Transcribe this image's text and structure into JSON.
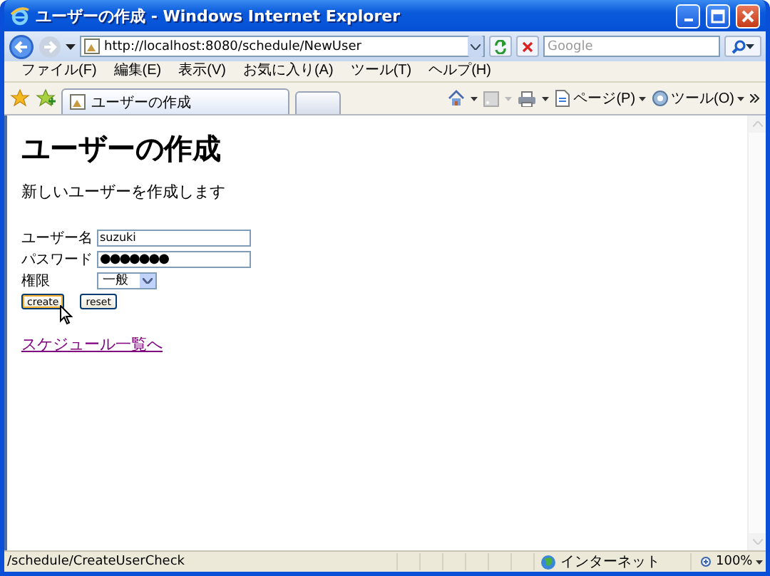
{
  "window": {
    "title": "ユーザーの作成 - Windows Internet Explorer"
  },
  "address_bar": {
    "url": "http://localhost:8080/schedule/NewUser"
  },
  "search": {
    "placeholder": "Google"
  },
  "menu": [
    "ファイル(F)",
    "編集(E)",
    "表示(V)",
    "お気に入り(A)",
    "ツール(T)",
    "ヘルプ(H)"
  ],
  "tabs": [
    {
      "label": "ユーザーの作成",
      "selected": true
    }
  ],
  "command_bar": [
    "ページ(P)",
    "ツール(O)"
  ],
  "page": {
    "heading": "ユーザーの作成",
    "intro": "新しいユーザーを作成します",
    "fields": [
      {
        "kind": "text",
        "label": "ユーザー名",
        "value": "suzuki"
      },
      {
        "kind": "password",
        "label": "パスワード",
        "value": "●●●●●●●"
      },
      {
        "kind": "select",
        "label": "権限",
        "value": "一般"
      }
    ],
    "buttons": [
      {
        "label": "create",
        "hovered": true
      },
      {
        "label": "reset",
        "hovered": false
      }
    ],
    "link": "スケジュール一覧へ"
  },
  "status_bar": {
    "text": "/schedule/CreateUserCheck",
    "zone": "インターネット",
    "zoom": "100%"
  }
}
